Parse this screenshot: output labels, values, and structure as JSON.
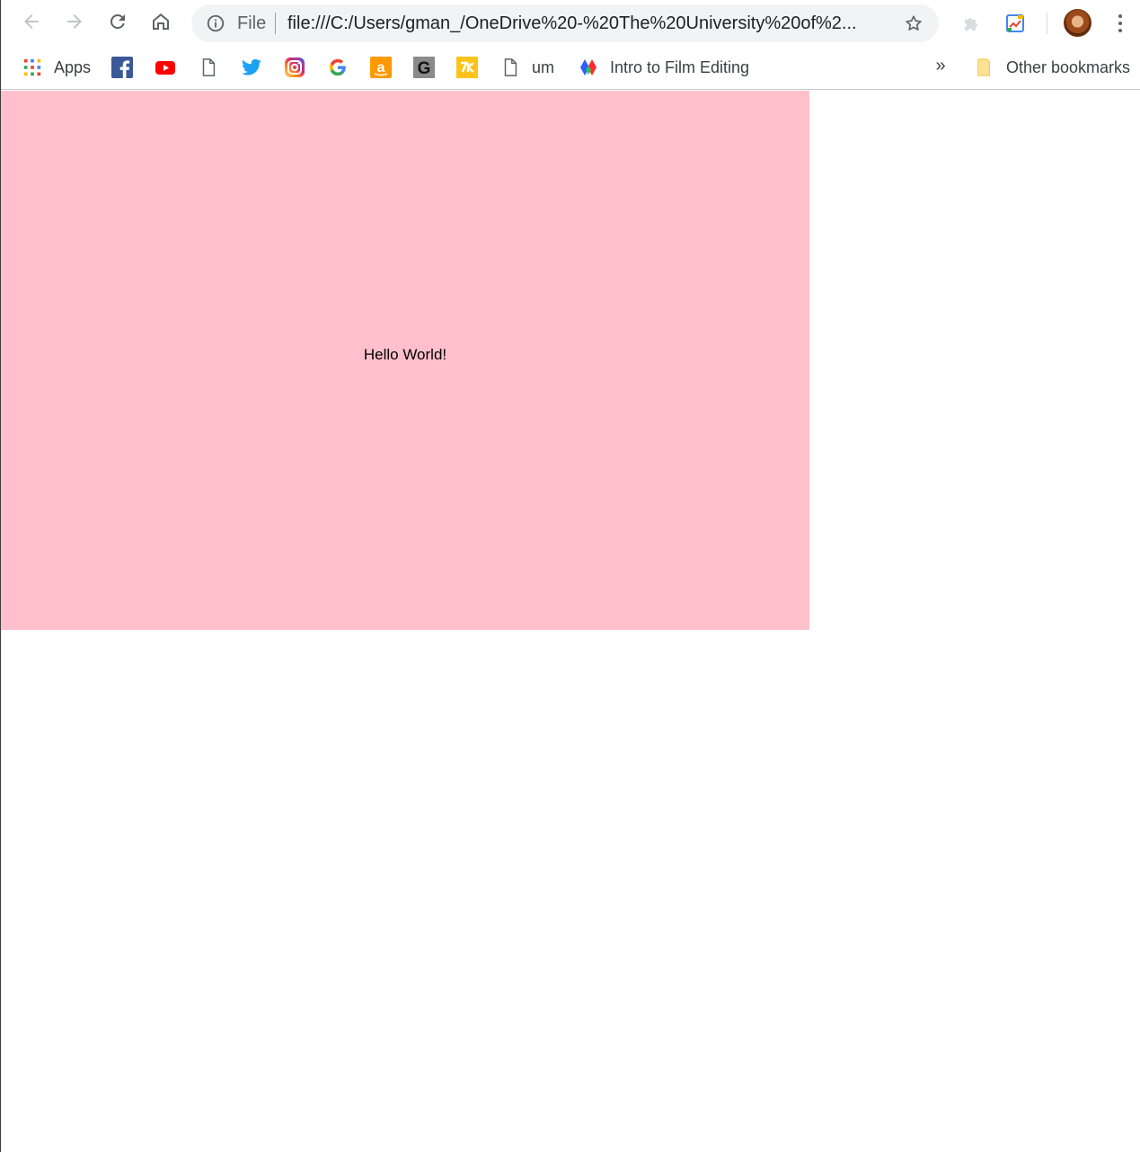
{
  "toolbar": {
    "back_icon": "arrow-left-icon",
    "forward_icon": "arrow-right-icon",
    "reload_icon": "reload-icon",
    "home_icon": "home-icon",
    "omnibox": {
      "info_icon": "info-icon",
      "scheme_label": "File",
      "url": "file:///C:/Users/gman_/OneDrive%20-%20The%20University%20of%2...",
      "star_icon": "star-icon"
    },
    "extensions": [
      "puzzle-extension-icon",
      "chart-extension-icon"
    ],
    "avatar_icon": "profile-avatar",
    "menu_icon": "three-dot-menu-icon"
  },
  "bookmarks": {
    "items": [
      {
        "label": "Apps",
        "icon": "apps-grid-icon"
      },
      {
        "label": "",
        "icon": "facebook-icon"
      },
      {
        "label": "",
        "icon": "youtube-icon"
      },
      {
        "label": "",
        "icon": "page-icon"
      },
      {
        "label": "",
        "icon": "twitter-icon"
      },
      {
        "label": "",
        "icon": "instagram-icon"
      },
      {
        "label": "",
        "icon": "google-icon"
      },
      {
        "label": "",
        "icon": "amazon-icon"
      },
      {
        "label": "",
        "icon": "g-letter-icon"
      },
      {
        "label": "",
        "icon": "yellow-tile-icon"
      },
      {
        "label": "um",
        "icon": "page-icon"
      },
      {
        "label": "Intro to Film Editing",
        "icon": "colorful-logo-icon"
      }
    ],
    "overflow_label": "»",
    "other_bookmarks": {
      "label": "Other bookmarks",
      "icon": "folder-icon"
    }
  },
  "page": {
    "box_text": "Hello World!",
    "colors": {
      "box_background": "#ffc0cb",
      "page_background": "#ffffff"
    }
  }
}
